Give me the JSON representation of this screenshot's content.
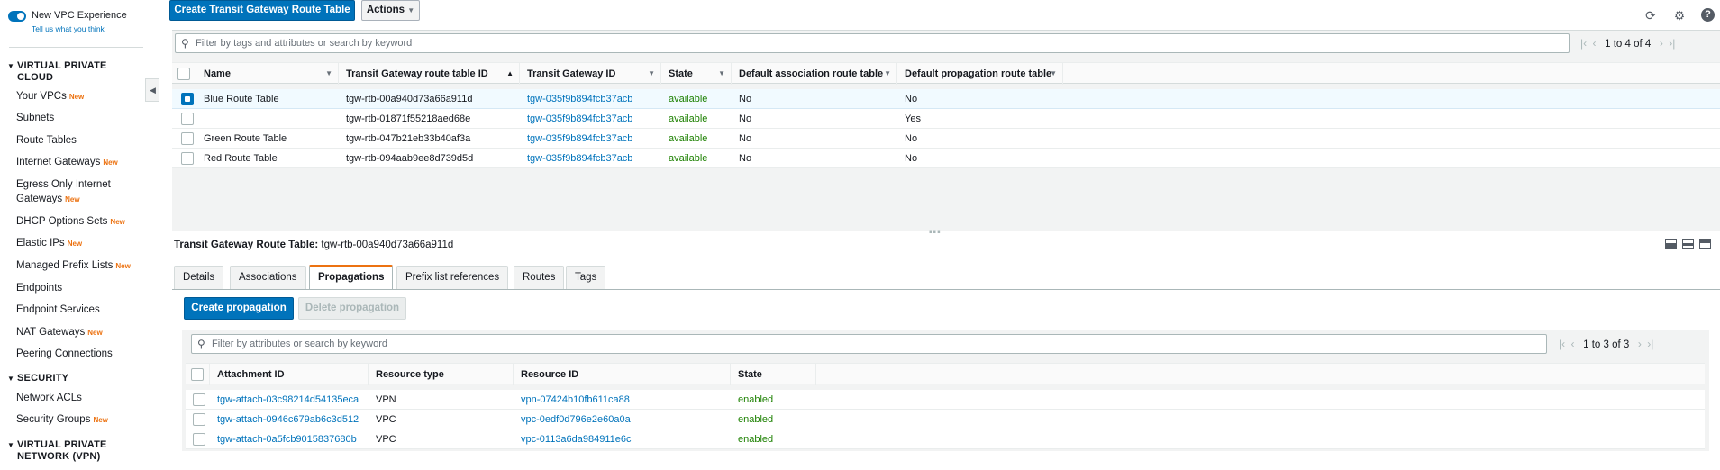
{
  "sidebar": {
    "new_vpc_experience": "New VPC Experience",
    "tell_us": "Tell us what you think",
    "sections": [
      {
        "title_line1": "VIRTUAL PRIVATE",
        "title_line2": "CLOUD"
      },
      {
        "title_line1": "SECURITY"
      },
      {
        "title_line1": "VIRTUAL PRIVATE",
        "title_line2": "NETWORK (VPN)"
      }
    ],
    "items": [
      {
        "label": "Your VPCs",
        "badge": "New"
      },
      {
        "label": "Subnets"
      },
      {
        "label": "Route Tables"
      },
      {
        "label": "Internet Gateways",
        "badge": "New"
      },
      {
        "label_line1": "Egress Only Internet",
        "label_line2": "Gateways",
        "badge": "New"
      },
      {
        "label": "DHCP Options Sets",
        "badge": "New"
      },
      {
        "label": "Elastic IPs",
        "badge": "New"
      },
      {
        "label": "Managed Prefix Lists",
        "badge": "New"
      },
      {
        "label": "Endpoints"
      },
      {
        "label": "Endpoint Services"
      },
      {
        "label": "NAT Gateways",
        "badge": "New"
      },
      {
        "label": "Peering Connections"
      },
      {
        "label": "Network ACLs"
      },
      {
        "label": "Security Groups",
        "badge": "New"
      }
    ]
  },
  "toolbar": {
    "create_label": "Create Transit Gateway Route Table",
    "actions_label": "Actions"
  },
  "top_grid": {
    "search_placeholder": "Filter by tags and attributes or search by keyword",
    "pager": "1 to 4 of 4",
    "columns": [
      "Name",
      "Transit Gateway route table ID",
      "Transit Gateway ID",
      "State",
      "Default association route table",
      "Default propagation route table"
    ],
    "rows": [
      {
        "name": "Blue Route Table",
        "rtb": "tgw-rtb-00a940d73a66a911d",
        "tgw": "tgw-035f9b894fcb37acb",
        "state": "available",
        "assoc": "No",
        "prop": "No",
        "selected": true
      },
      {
        "name": "",
        "rtb": "tgw-rtb-01871f55218aed68e",
        "tgw": "tgw-035f9b894fcb37acb",
        "state": "available",
        "assoc": "No",
        "prop": "Yes",
        "selected": false
      },
      {
        "name": "Green Route Table",
        "rtb": "tgw-rtb-047b21eb33b40af3a",
        "tgw": "tgw-035f9b894fcb37acb",
        "state": "available",
        "assoc": "No",
        "prop": "No",
        "selected": false
      },
      {
        "name": "Red Route Table",
        "rtb": "tgw-rtb-094aab9ee8d739d5d",
        "tgw": "tgw-035f9b894fcb37acb",
        "state": "available",
        "assoc": "No",
        "prop": "No",
        "selected": false
      }
    ]
  },
  "detail": {
    "title_label": "Transit Gateway Route Table:",
    "title_value": "tgw-rtb-00a940d73a66a911d",
    "tabs": [
      "Details",
      "Associations",
      "Propagations",
      "Prefix list references",
      "Routes",
      "Tags"
    ],
    "active_tab": "Propagations",
    "create_propagation": "Create propagation",
    "delete_propagation": "Delete propagation",
    "search_placeholder": "Filter by attributes or search by keyword",
    "pager": "1 to 3 of 3",
    "columns": [
      "Attachment ID",
      "Resource type",
      "Resource ID",
      "State"
    ],
    "rows": [
      {
        "attachment": "tgw-attach-03c98214d54135eca",
        "type": "VPN",
        "resource": "vpn-07424b10fb611ca88",
        "state": "enabled"
      },
      {
        "attachment": "tgw-attach-0946c679ab6c3d512",
        "type": "VPC",
        "resource": "vpc-0edf0d796e2e60a0a",
        "state": "enabled"
      },
      {
        "attachment": "tgw-attach-0a5fcb9015837680b",
        "type": "VPC",
        "resource": "vpc-0113a6da984911e6c",
        "state": "enabled"
      }
    ]
  },
  "icons": {
    "refresh": "refresh-icon",
    "settings": "gear-icon",
    "help": "help-icon"
  },
  "colors": {
    "primary": "#0073bb",
    "link": "#0073bb",
    "available": "#1d8102",
    "active_tab_accent": "#ec7211",
    "new_badge": "#ec7211"
  }
}
